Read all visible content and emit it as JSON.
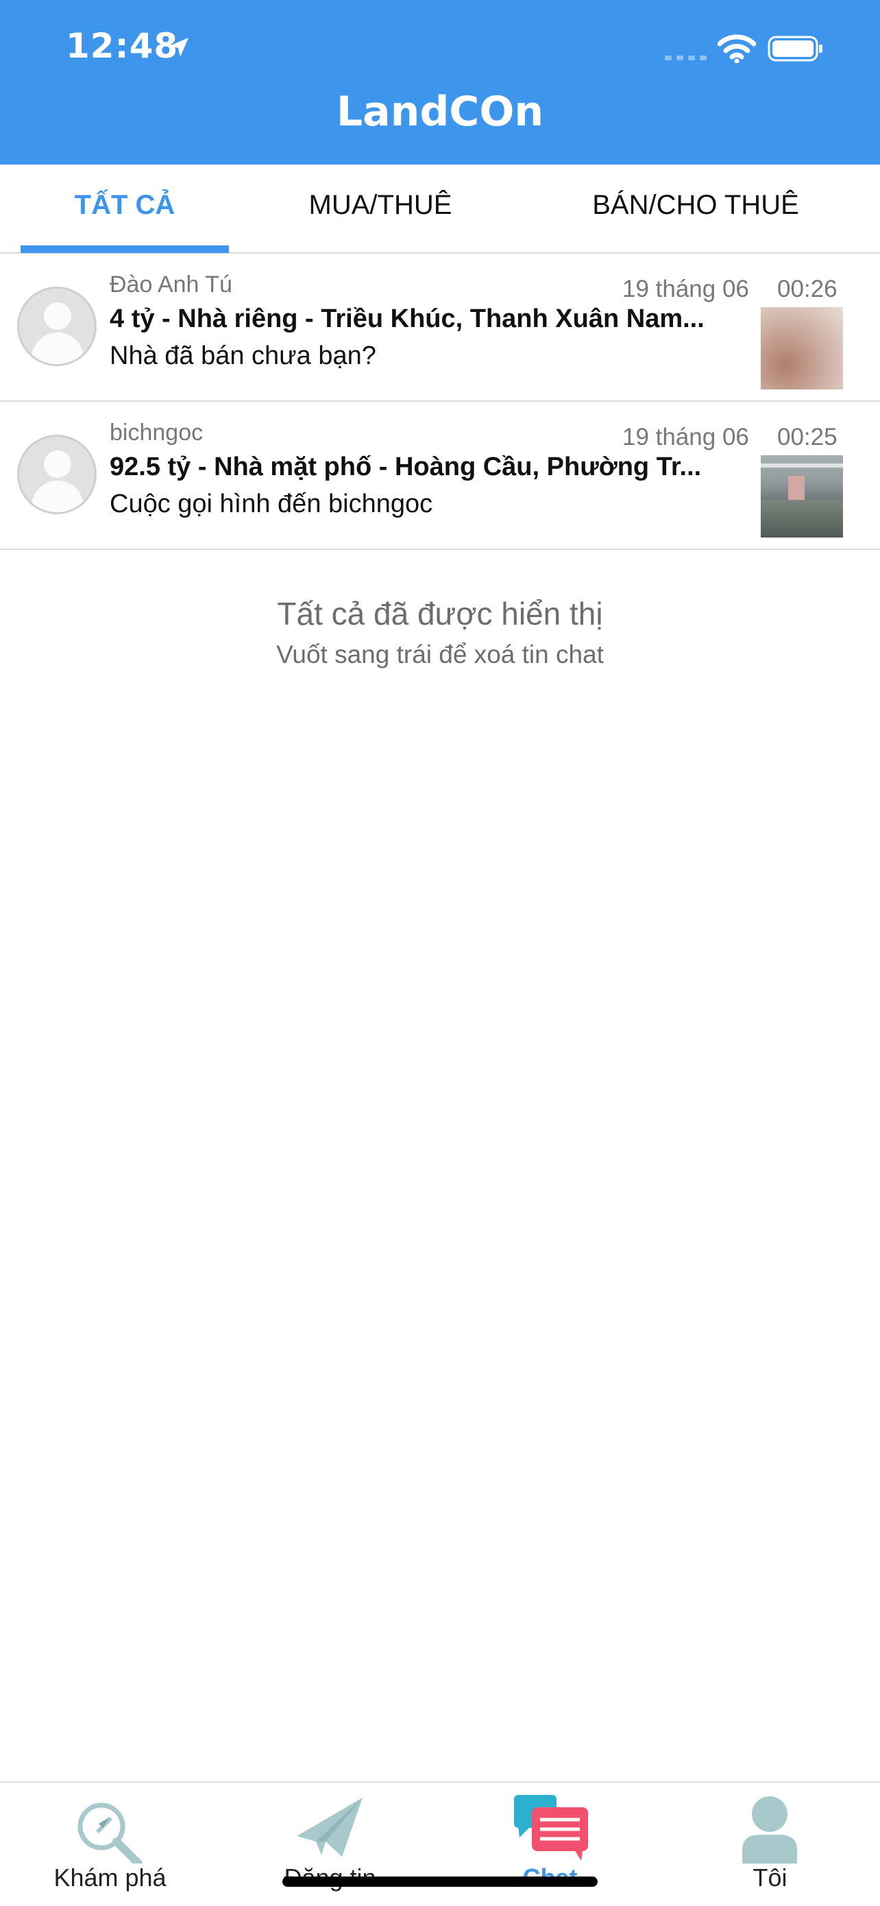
{
  "status_bar": {
    "time": "12:48",
    "icons": [
      "location-arrow-icon",
      "cellular-signal-icon",
      "wifi-icon",
      "battery-icon"
    ]
  },
  "header": {
    "logo_text": "LandCOn",
    "background_color": "#3d95ec"
  },
  "tabs": [
    {
      "label": "TẤT CẢ",
      "active": true
    },
    {
      "label": "MUA/THUÊ",
      "active": false
    },
    {
      "label": "BÁN/CHO THUÊ",
      "active": false
    }
  ],
  "chats": [
    {
      "sender": "Đào Anh Tú",
      "date": "19 tháng 06",
      "time": "00:26",
      "listing": "4 tỷ - Nhà riêng - Triều Khúc, Thanh Xuân Nam...",
      "preview": "Nhà đã bán chưa bạn?"
    },
    {
      "sender": "bichngoc",
      "date": "19 tháng 06",
      "time": "00:25",
      "listing": "92.5 tỷ - Nhà mặt phố - Hoàng Cầu, Phường Tr...",
      "preview": "Cuộc gọi hình đến bichngoc"
    }
  ],
  "end_message": {
    "title": "Tất cả đã được hiển thị",
    "subtitle": "Vuốt sang trái để xoá tin chat"
  },
  "bottom_nav": [
    {
      "label": "Khám phá",
      "icon": "compass-search-icon",
      "active": false
    },
    {
      "label": "Đăng tin",
      "icon": "paper-plane-icon",
      "active": false
    },
    {
      "label": "Chat",
      "icon": "chat-bubbles-icon",
      "active": true
    },
    {
      "label": "Tôi",
      "icon": "user-icon",
      "active": false
    }
  ],
  "colors": {
    "accent": "#3d95ec",
    "chat_icon_pink": "#f2506f",
    "chat_icon_teal": "#2bb1cf"
  }
}
